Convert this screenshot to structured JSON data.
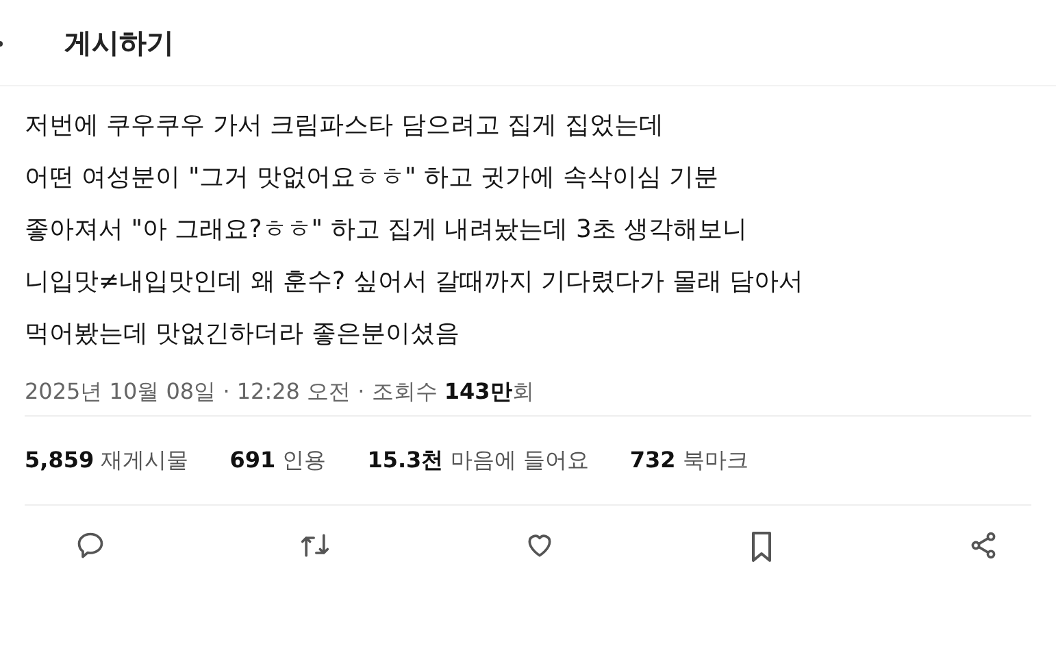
{
  "header": {
    "title": "게시하기"
  },
  "post": {
    "text": "저번에 쿠우쿠우 가서 크림파스타 담으려고 집게 집었는데\n어떤 여성분이 \"그거 맛없어요ㅎㅎ\" 하고 귓가에 속삭이심 기분\n좋아져서 \"아 그래요?ㅎㅎ\" 하고 집게 내려놨는데 3초 생각해보니\n니입맛≠내입맛인데 왜 훈수? 싶어서 갈때까지 기다렸다가 몰래 담아서\n먹어봤는데 맛없긴하더라 좋은분이셨음",
    "meta": "2025년 10월 08일 · 12:28 오전 · 조회수 **143만**회"
  },
  "stats": [
    {
      "count": "5,859",
      "label": "재게시물"
    },
    {
      "count": "691",
      "label": "인용"
    },
    {
      "count": "15.3천",
      "label": "마음에 들어요"
    },
    {
      "count": "732",
      "label": "북마크"
    }
  ],
  "actions": [
    {
      "kind": "reply"
    },
    {
      "kind": "repost"
    },
    {
      "kind": "like"
    },
    {
      "kind": "bookmark"
    },
    {
      "kind": "share"
    }
  ]
}
